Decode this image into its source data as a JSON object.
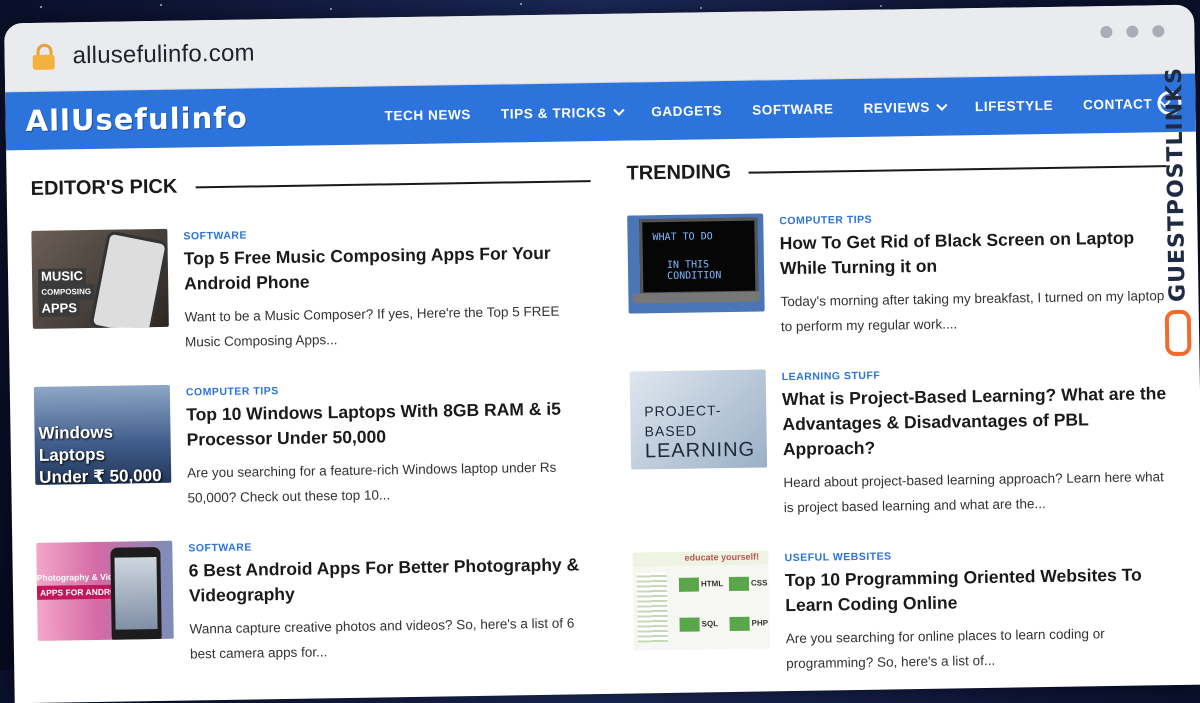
{
  "browser": {
    "url": "allusefulinfo.com"
  },
  "site": {
    "logo": "AllUsefulinfo",
    "nav": [
      {
        "label": "TECH NEWS",
        "dropdown": false
      },
      {
        "label": "TIPS & TRICKS",
        "dropdown": true
      },
      {
        "label": "GADGETS",
        "dropdown": false
      },
      {
        "label": "SOFTWARE",
        "dropdown": false
      },
      {
        "label": "REVIEWS",
        "dropdown": true
      },
      {
        "label": "LIFESTYLE",
        "dropdown": false
      },
      {
        "label": "CONTACT",
        "dropdown": true
      }
    ]
  },
  "editors_pick": {
    "title": "EDITOR'S PICK",
    "posts": [
      {
        "category": "SOFTWARE",
        "title": "Top 5 Free Music Composing Apps For Your Android Phone",
        "excerpt": "Want to be a Music Composer? If yes, Here're the Top 5 FREE Music Composing Apps...",
        "thumb_text": [
          "MUSIC",
          "COMPOSING",
          "APPS"
        ]
      },
      {
        "category": "COMPUTER TIPS",
        "title": "Top 10 Windows Laptops With 8GB RAM & i5 Processor Under 50,000",
        "excerpt": "Are you searching for a feature-rich Windows laptop under Rs 50,000? Check out these top 10...",
        "thumb_text": [
          "Windows Laptops",
          "Under ₹ 50,000"
        ]
      },
      {
        "category": "SOFTWARE",
        "title": "6 Best Android Apps For Better Photography & Videography",
        "excerpt": "Wanna capture creative photos and videos? So, here's a list of 6 best camera apps for...",
        "thumb_text": [
          "Photography & Videography",
          "APPS FOR ANDROID"
        ]
      }
    ]
  },
  "trending": {
    "title": "TRENDING",
    "posts": [
      {
        "category": "COMPUTER TIPS",
        "title": "How To Get Rid of Black Screen on Laptop While Turning it on",
        "excerpt": "Today's morning after taking my breakfast, I turned on my laptop to perform my regular work....",
        "thumb_text": [
          "WHAT TO DO",
          "IN THIS CONDITION"
        ]
      },
      {
        "category": "LEARNING STUFF",
        "title": "What is Project-Based Learning? What are the Advantages & Disadvantages of PBL Approach?",
        "excerpt": "Heard about project-based learning approach? Learn here what is project based learning and what are the...",
        "thumb_text": [
          "PROJECT-BASED",
          "LEARNING"
        ]
      },
      {
        "category": "USEFUL WEBSITES",
        "title": "Top 10 Programming Oriented Websites To Learn Coding Online",
        "excerpt": "Are you searching for online places to learn coding or programming? So, here's a list of...",
        "thumb_text": [
          "educate yourself!",
          "HTML",
          "CSS",
          "SQL",
          "PHP"
        ]
      }
    ]
  },
  "watermark": "GUESTPOSTLINKS"
}
